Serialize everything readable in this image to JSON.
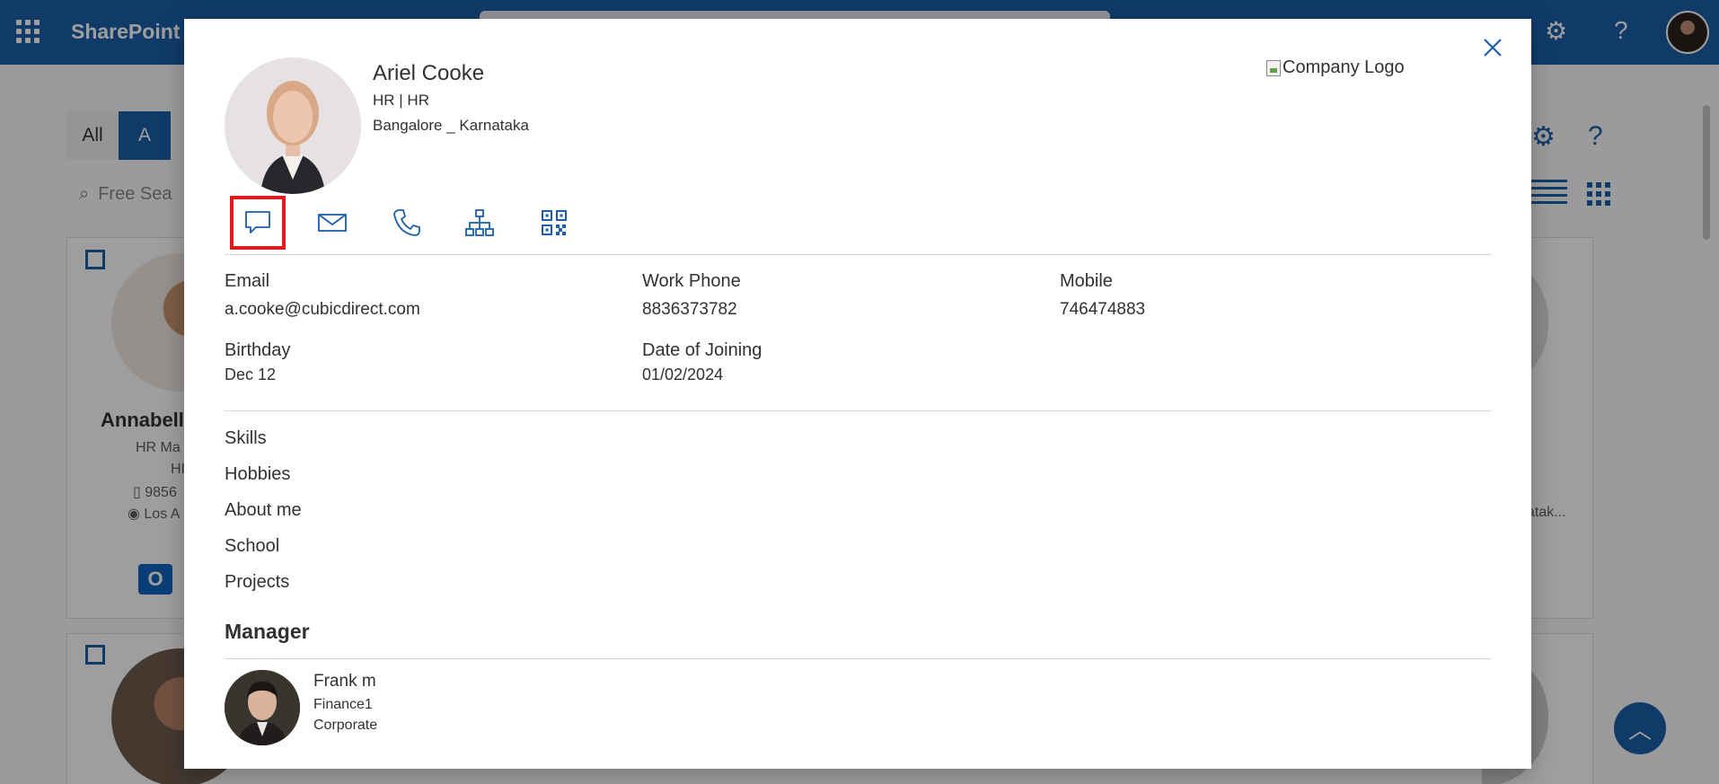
{
  "suite_bar": {
    "app_name": "SharePoint",
    "icons": [
      "app-launcher-icon",
      "settings-icon",
      "help-icon",
      "user-avatar"
    ]
  },
  "background": {
    "filter_all": "All",
    "filter_letter": "A",
    "search_placeholder": "Free Sea",
    "cards": [
      {
        "name": "Annabella",
        "title": "HR Ma",
        "dept": "HI",
        "phone": "9856",
        "location": "Los A"
      },
      {
        "location_suffix": "atak..."
      }
    ]
  },
  "profile": {
    "name": "Ariel Cooke",
    "dept_line": "HR | HR",
    "location": "Bangalore _ Karnataka",
    "company_logo_alt": "Company Logo",
    "actions": [
      {
        "name": "chat-button",
        "icon": "chat-icon",
        "selected": true
      },
      {
        "name": "mail-button",
        "icon": "mail-icon"
      },
      {
        "name": "call-button",
        "icon": "phone-icon"
      },
      {
        "name": "org-chart-button",
        "icon": "org-chart-icon"
      },
      {
        "name": "qr-code-button",
        "icon": "qr-code-icon"
      }
    ],
    "fields": {
      "email_label": "Email",
      "email_value": "a.cooke@cubicdirect.com",
      "work_phone_label": "Work Phone",
      "work_phone_value": "8836373782",
      "mobile_label": "Mobile",
      "mobile_value": "746474883",
      "birthday_label": "Birthday",
      "birthday_value": "Dec 12",
      "doj_label": "Date of Joining",
      "doj_value": "01/02/2024"
    },
    "sections": [
      "Skills",
      "Hobbies",
      "About me",
      "School",
      "Projects"
    ],
    "manager": {
      "heading": "Manager",
      "name": "Frank m",
      "dept": "Finance1",
      "location": "Corporate"
    }
  },
  "colors": {
    "brand_blue": "#1b5faa",
    "highlight_red": "#e01b1b"
  }
}
